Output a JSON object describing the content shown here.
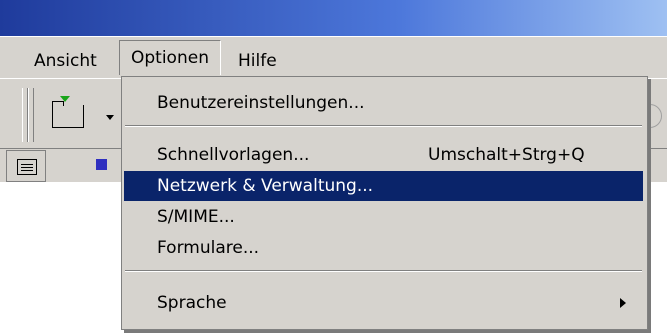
{
  "menubar": {
    "items": [
      {
        "label": "Ansicht"
      },
      {
        "label": "Optionen",
        "state": "open"
      },
      {
        "label": "Hilfe"
      }
    ]
  },
  "dropdown": {
    "items": [
      {
        "label": "Benutzereinstellungen..."
      },
      {
        "label": "Schnellvorlagen...",
        "shortcut": "Umschalt+Strg+Q"
      },
      {
        "label": "Netzwerk & Verwaltung...",
        "highlighted": true
      },
      {
        "label": "S/MIME..."
      },
      {
        "label": "Formulare..."
      },
      {
        "label": "Sprache",
        "submenu": true
      }
    ]
  },
  "colors": {
    "menu_bg": "#d6d3ce",
    "highlight": "#0a246a",
    "titlebar": "#1f3b9c"
  },
  "icons": [
    "new-folder-icon",
    "dropdown-arrow-icon",
    "circle-icon",
    "list-view-icon",
    "blue-square-icon",
    "submenu-arrow-icon"
  ]
}
